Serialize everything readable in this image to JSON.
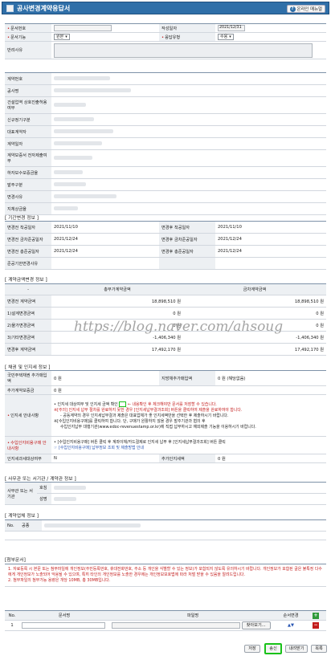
{
  "window": {
    "title": "공사변경계약응답서",
    "help_label": "온라인 매뉴얼"
  },
  "top": {
    "doc_no_label": "문서번호",
    "date_label": "작성일자",
    "date_value": "2021/12/31",
    "func_label": "문서기능",
    "func_value": "원본",
    "resp_type_label": "응답유형",
    "resp_type_value": "수용",
    "reason_label": "반려사유"
  },
  "contract_fields": [
    "계약번호",
    "공사명",
    "건설업역 상호진출허용여부",
    "신규정기구분",
    "대표계약자",
    "계약일자",
    "계약보증서 전자제출여부",
    "하자보수보증금율",
    "발주구분",
    "변경사유",
    "지체상금율"
  ],
  "period": {
    "title": "[ 기간변경 정보 ]",
    "rows": [
      {
        "l1": "변경전 착공일자",
        "v1": "2021/11/10",
        "l2": "변경후 착공일자",
        "v2": "2021/11/10"
      },
      {
        "l1": "변경전 금차준공일자",
        "v1": "2021/12/24",
        "l2": "변경후 금차준공일자",
        "v2": "2021/12/24"
      },
      {
        "l1": "변경전 총준공일자",
        "v1": "2021/12/24",
        "l2": "변경후 총준공일자",
        "v2": "2021/12/24"
      },
      {
        "l1": "준공기한변경사유",
        "v1": "",
        "l2": "",
        "v2": ""
      }
    ]
  },
  "amount": {
    "title": "[ 계약금액변경 정보 ]",
    "col_total": "총부가계약금액",
    "col_this": "금차계약금액",
    "rows": [
      {
        "label": "변경전 계약금액",
        "total": "18,898,510 원",
        "this": "18,898,510 원"
      },
      {
        "label": "1)설계변경금액",
        "total": "0 원",
        "this": "0 원"
      },
      {
        "label": "2)물가변경금액",
        "total": "0 원",
        "this": "0 원"
      },
      {
        "label": "3)기타변경금액",
        "total": "-1,406,340 원",
        "this": "-1,406,340 원"
      },
      {
        "label": "변경후 계약금액",
        "total": "17,492,170 원",
        "this": "17,492,170 원"
      }
    ]
  },
  "bond": {
    "title": "[ 채권 및 인지세 정보 ]",
    "bond_label": "국민주택채권 추가매입액",
    "bond_value": "0 원",
    "region_label": "지방채추가매입액",
    "region_value": "0 원 (해당없음)",
    "extra_label": "추가계약보증금",
    "extra_value": "0 원",
    "stamp_label": "인지세 안내사항",
    "stamp_lines": [
      "• 인지세 대상여부 및 인지세 금액 확인",
      "← 내용확인 후 체크해야만 문서를 저장할 수 있습니다.",
      "※[주의] 인지세 납부 절차를 완료하지 못한 경우",
      "[인지세납부결과조회] 버튼을 클릭하여 제출을 완료하여야 합니다.",
      "- 공동계약의 경우 인지세납부결과 제출은 대표업체가 좋 인지세액만을 선택한 후 제출하시기 바랍니다.",
      "※[수입인지비용구매]를 클릭하여 합니다. 단, 구매가 원활하지 않을 경우 발주기관과 협의 후",
      "수입인지납부 대행기관(www.edoc-revenuestamp.or.kr)에 직접 납부하시고 예외제출 기능을 이용하시기 바랍니다."
    ],
    "purchase_label": "수입인지비용구매 안내사항",
    "purchase_lines": [
      "• [수입인지비용구매] 버튼 클릭 후 계좌이체/카드결제로 인지세 납부 후 [인지세납부결과조회] 버튼 클릭",
      "☞ [수입인지비용구매] 납부정보 조회 및 제출방법 안내"
    ],
    "except_label": "인지세과세대상여부",
    "except_value": "N",
    "add_label": "추가인지세액",
    "add_value": "0 원"
  },
  "office": {
    "title": "[ 사무관 또는 서기관 / 계약관 정보 ]",
    "label": "사무관 또는 서기관",
    "sub1": "호칭",
    "sub2": "성명"
  },
  "company": {
    "title": "[ 계약업체 정보 ]",
    "col_no": "No.",
    "col_name": "공종"
  },
  "attach": {
    "title": "[첨부문서]",
    "notes": [
      "1. 자료등록 시 본문 또는 첨부파일에 개인정보(주민등록번호, 휴대전화번호, 주소 등 개인을 식별할 수 있는 정보)가 포함되지 않도록 유의하시기 바랍니다. 개인정보가 포함된 글은 불특정 다수에게 개인정보가 노출되어 악용될 수 있으며, 특히 타인의 개인정보를 노출한 경우에는 개인정보보호법에 따라 처벌 받을 수 있음을 알려드립니다.",
      "2. 첨부파일의 첨부가능 용량은 개당 10MB, 총 30MB입니다."
    ],
    "col_no": "No.",
    "col_doc": "문서명",
    "col_file": "파일명",
    "col_order": "순서변경",
    "row_no": "1",
    "browse_label": "찾아보기..."
  },
  "buttons": {
    "save": "저장",
    "send": "송신",
    "print": "내려받기",
    "list": "목록"
  },
  "watermark": "https://blog.naver.com/ahsoug",
  "colors": {
    "titlebar": "#2f6fa8",
    "required": "#c31c1c",
    "highlight": "#19c219"
  }
}
